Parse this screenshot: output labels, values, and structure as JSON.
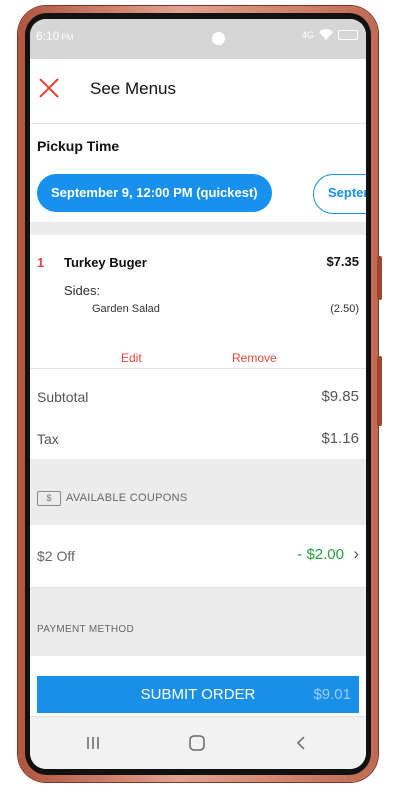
{
  "status_bar": {
    "time": "6:10",
    "meridiem": "PM",
    "network": "4G"
  },
  "header": {
    "title": "See Menus",
    "close_icon": "close-icon"
  },
  "pickup": {
    "heading": "Pickup Time",
    "options": [
      {
        "label": "September 9, 12:00 PM (quickest)",
        "selected": true
      },
      {
        "label": "Septem",
        "selected": false
      }
    ]
  },
  "order_item": {
    "quantity": "1",
    "name": "Turkey Buger",
    "price": "$7.35",
    "sides_label": "Sides:",
    "side_name": "Garden Salad",
    "side_price": "(2.50)",
    "edit_label": "Edit",
    "remove_label": "Remove"
  },
  "totals": {
    "subtotal_label": "Subtotal",
    "subtotal_value": "$9.85",
    "tax_label": "Tax",
    "tax_value": "$1.16"
  },
  "coupons": {
    "section_label": "AVAILABLE COUPONS",
    "coupon_icon_text": "$",
    "coupon_name": "$2 Off",
    "coupon_amount": "- $2.00"
  },
  "payment": {
    "section_label": "PAYMENT METHOD"
  },
  "submit": {
    "label": "SUBMIT ORDER",
    "amount": "$9.01"
  },
  "colors": {
    "accent": "#1890ee",
    "danger": "#e8473b",
    "success": "#23a33b"
  }
}
